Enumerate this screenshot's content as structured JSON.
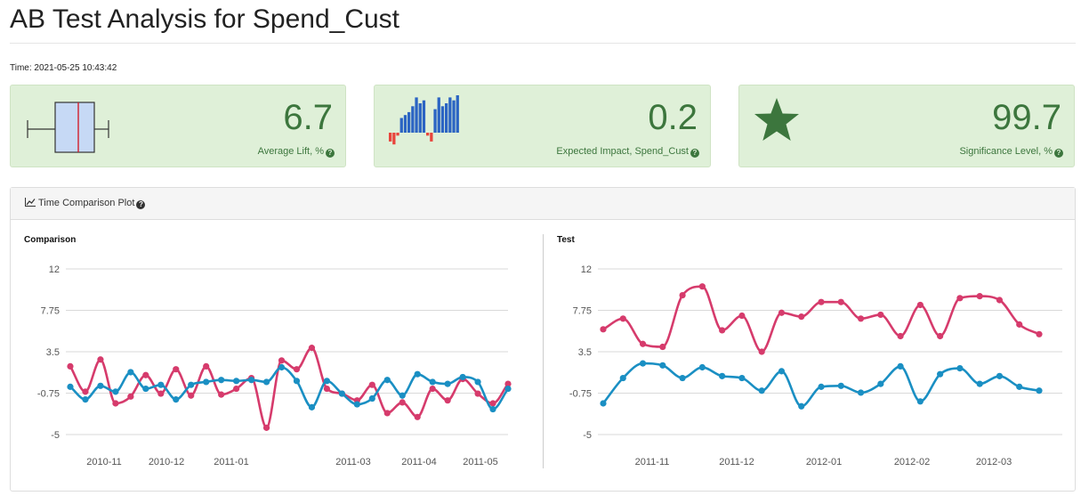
{
  "page": {
    "title": "AB Test Analysis for Spend_Cust",
    "time": "Time: 2021-05-25 10:43:42"
  },
  "cards": [
    {
      "value": "6.7",
      "label": "Average Lift, %",
      "icon": "boxplot-icon"
    },
    {
      "value": "0.2",
      "label": "Expected Impact, Spend_Cust",
      "icon": "histogram-icon",
      "bar_values": [
        -3,
        -4,
        -1,
        5,
        6,
        7,
        9,
        12,
        10,
        11,
        -1,
        -3,
        8,
        12,
        9,
        10,
        12,
        11,
        13
      ]
    },
    {
      "value": "99.7",
      "label": "Significance Level, %",
      "icon": "star-icon"
    }
  ],
  "panel": {
    "title": "Time Comparison Plot"
  },
  "colors": {
    "series_a": "#d63b6c",
    "series_b": "#1a8fc3",
    "card_text": "#3c763d",
    "card_bg": "#dff0d8"
  },
  "chart_data": [
    {
      "type": "line",
      "title": "Comparison",
      "yticks": [
        "12",
        "7.75",
        "3.5",
        "-0.75",
        "-5"
      ],
      "ylim": [
        -5,
        12
      ],
      "xtick_labels": [
        "2010-11",
        "2010-12",
        "2011-01",
        "2011-03",
        "2011-04",
        "2011-05"
      ],
      "series": [
        {
          "values": [
            2.0,
            -0.6,
            2.7,
            -1.8,
            -1.1,
            1.1,
            -0.8,
            1.7,
            -1.0,
            2.0,
            -0.9,
            -0.3,
            0.8,
            -4.3,
            2.6,
            1.7,
            3.9,
            -0.3,
            -0.8,
            -1.5,
            0.1,
            -2.8,
            -1.7,
            -3.2,
            -0.3,
            -1.5,
            0.7,
            -0.8,
            -1.8,
            0.2
          ]
        },
        {
          "values": [
            -0.1,
            -1.4,
            0.0,
            -0.6,
            1.4,
            -0.3,
            0.1,
            -1.4,
            0.1,
            0.4,
            0.6,
            0.5,
            0.6,
            0.4,
            1.9,
            0.5,
            -2.2,
            0.5,
            -0.8,
            -1.9,
            -1.3,
            0.6,
            -1.0,
            1.2,
            0.4,
            0.2,
            0.9,
            0.4,
            -2.4,
            -0.3
          ]
        }
      ]
    },
    {
      "type": "line",
      "title": "Test",
      "yticks": [
        "12",
        "7.75",
        "3.5",
        "-0.75",
        "-5"
      ],
      "ylim": [
        -5,
        12
      ],
      "xtick_labels": [
        "2011-11",
        "2011-12",
        "2012-01",
        "2012-02",
        "2012-03"
      ],
      "series": [
        {
          "values": [
            5.8,
            6.9,
            4.3,
            4.0,
            9.3,
            10.2,
            5.7,
            7.2,
            3.5,
            7.5,
            7.1,
            8.6,
            8.6,
            6.9,
            7.3,
            5.1,
            8.3,
            5.1,
            9.0,
            9.2,
            8.8,
            6.3,
            5.3
          ]
        },
        {
          "values": [
            -1.8,
            0.8,
            2.3,
            2.1,
            0.8,
            1.9,
            1.0,
            0.8,
            -0.5,
            1.5,
            -2.1,
            -0.1,
            0.0,
            -0.7,
            0.2,
            2.0,
            -1.6,
            1.2,
            1.8,
            0.2,
            1.0,
            -0.1,
            -0.5
          ]
        }
      ]
    }
  ]
}
